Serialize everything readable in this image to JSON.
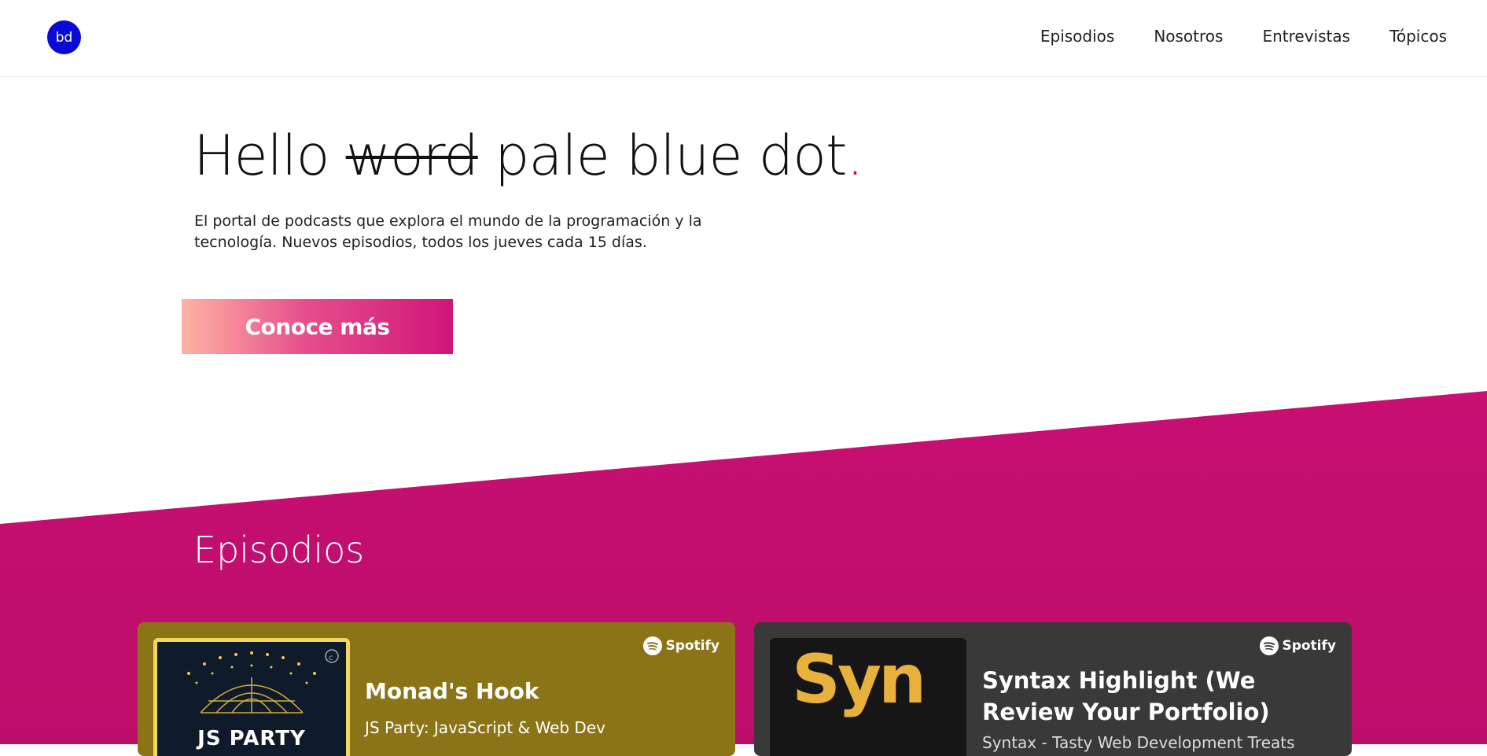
{
  "header": {
    "logo_text": "bd",
    "nav": [
      "Episodios",
      "Nosotros",
      "Entrevistas",
      "Tópicos"
    ]
  },
  "hero": {
    "title_prefix": "Hello",
    "title_strike": "word",
    "title_main": "pale blue dot",
    "title_dot": ".",
    "description": "El portal de podcasts que explora el mundo de la programación y la tecnología. Nuevos episodios, todos los jueves cada 15 días.",
    "cta": "Conoce más"
  },
  "episodes": {
    "title": "Episodios",
    "cards": [
      {
        "title": "Monad's Hook",
        "subtitle": "JS Party: JavaScript & Web Dev",
        "cover_text": "JS PARTY",
        "badge": "Spotify",
        "colors": {
          "bg": "#8b7417"
        }
      },
      {
        "title": "Syntax Highlight (We Review Your Portfolio)",
        "subtitle": "Syntax - Tasty Web Development Treats",
        "cover_text": "Syn",
        "badge": "Spotify",
        "colors": {
          "bg": "#393939"
        }
      }
    ]
  },
  "colors": {
    "accent": "#c8106f",
    "logo": "#0a0ad6"
  },
  "icons": [
    "spotify-icon"
  ]
}
